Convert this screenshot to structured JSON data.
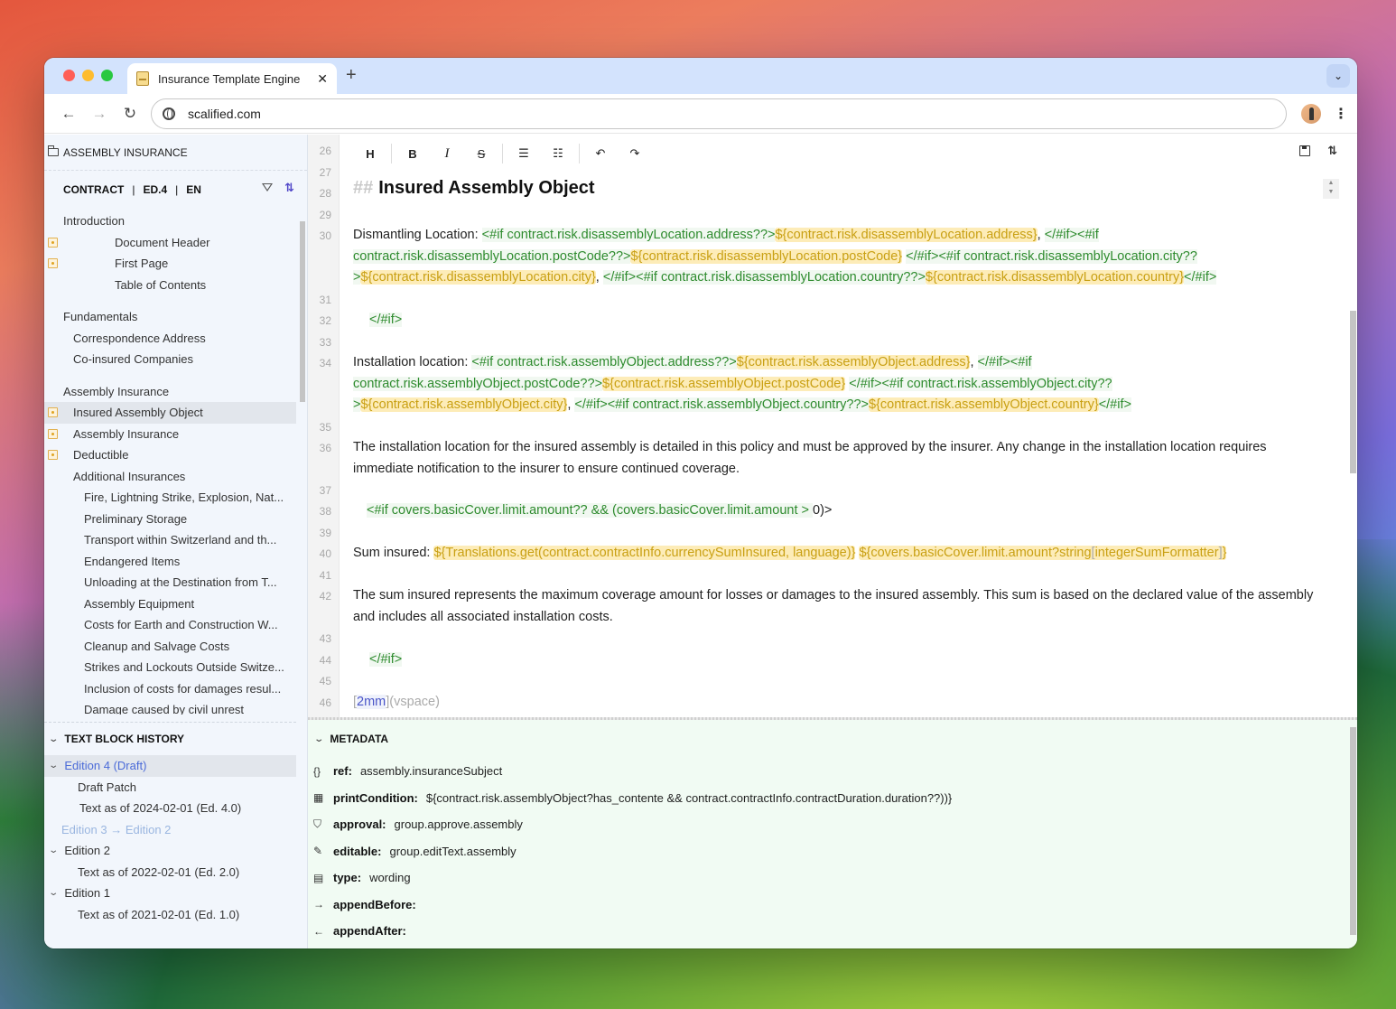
{
  "browser": {
    "tab_title": "Insurance Template Engine",
    "url": "scalified.com",
    "close_glyph": "✕",
    "new_tab_glyph": "+",
    "back_glyph": "←",
    "forward_glyph": "→",
    "reload_glyph": "↻",
    "menu_glyph": "⋮",
    "tab_menu_glyph": "⌄"
  },
  "sidebar": {
    "title": "ASSEMBLY INSURANCE",
    "context": {
      "type": "CONTRACT",
      "edition": "ED.4",
      "language": "EN",
      "separator": "|"
    },
    "sync_glyph": "⇅",
    "tree": [
      {
        "label": "Introduction",
        "level": 0,
        "group": true,
        "first": true
      },
      {
        "label": "Document Header",
        "level": 3,
        "marker": true
      },
      {
        "label": "First Page",
        "level": 3,
        "marker": true
      },
      {
        "label": "Table of Contents",
        "level": 3
      },
      {
        "label": "Fundamentals",
        "level": 0,
        "group": true
      },
      {
        "label": "Correspondence Address",
        "level": 1
      },
      {
        "label": "Co-insured Companies",
        "level": 1
      },
      {
        "label": "Assembly Insurance",
        "level": 0,
        "group": true
      },
      {
        "label": "Insured Assembly Object",
        "level": 1,
        "marker": true,
        "selected": true
      },
      {
        "label": "Assembly Insurance",
        "level": 1,
        "marker": true
      },
      {
        "label": "Deductible",
        "level": 1,
        "marker": true
      },
      {
        "label": "Additional Insurances",
        "level": 1
      },
      {
        "label": "Fire, Lightning Strike, Explosion, Nat...",
        "level": 2
      },
      {
        "label": "Preliminary Storage",
        "level": 2
      },
      {
        "label": "Transport within Switzerland and th...",
        "level": 2
      },
      {
        "label": "Endangered Items",
        "level": 2
      },
      {
        "label": "Unloading at the Destination from T...",
        "level": 2
      },
      {
        "label": "Assembly Equipment",
        "level": 2
      },
      {
        "label": "Costs for Earth and Construction W...",
        "level": 2
      },
      {
        "label": "Cleanup and Salvage Costs",
        "level": 2
      },
      {
        "label": "Strikes and Lockouts Outside Switze...",
        "level": 2
      },
      {
        "label": "Inclusion of costs for damages resul...",
        "level": 2
      },
      {
        "label": "Damage caused by civil unrest",
        "level": 2
      }
    ]
  },
  "history": {
    "title": "TEXT BLOCK HISTORY",
    "chevron": "⌄",
    "items": [
      {
        "label": "Edition 4 (Draft)",
        "kind": "edition",
        "selected": true,
        "expanded": true
      },
      {
        "label": "Draft Patch",
        "kind": "child"
      },
      {
        "label": "Text as of 2024-02-01 (Ed. 4.0)",
        "kind": "child2"
      },
      {
        "label": "Edition 3 → Edition 2",
        "kind": "muted"
      },
      {
        "label": "Edition 2",
        "kind": "edition",
        "expanded": true
      },
      {
        "label": "Text as of 2022-02-01 (Ed. 2.0)",
        "kind": "child"
      },
      {
        "label": "Edition 1",
        "kind": "edition",
        "expanded": true
      },
      {
        "label": "Text as of 2021-02-01 (Ed. 1.0)",
        "kind": "child"
      }
    ]
  },
  "editor": {
    "toolbar": {
      "heading": "H",
      "bold": "B",
      "italic": "I",
      "strike": "S",
      "bullet_list": "☰",
      "ordered_list": "☷",
      "undo": "↶",
      "redo": "↷"
    },
    "line_numbers": [
      "26",
      "27",
      "28",
      "29",
      "30",
      "31",
      "32",
      "33",
      "34",
      "35",
      "36",
      "37",
      "38",
      "39",
      "40",
      "41",
      "42",
      "43",
      "44",
      "45",
      "46"
    ],
    "heading": {
      "hashes": "##",
      "text": "Insured Assembly Object"
    },
    "dismantling": {
      "label": "Dismantling Location: ",
      "if_address": "<#if contract.risk.disassemblyLocation.address??>",
      "var_address": "${contract.risk.disassemblyLocation.address}",
      "comma1": ", ",
      "endif1": "</#if>",
      "if_postcode_a": "<#if",
      "if_postcode_b": "contract.risk.disassemblyLocation.postCode??>",
      "var_postcode": "${contract.risk.disassemblyLocation.postCode}",
      "endif2": "</#if>",
      "if_city": "<#if contract.risk.disassemblyLocation.city??",
      "if_city_close": ">",
      "var_city": "${contract.risk.disassemblyLocation.city}",
      "comma2": ", ",
      "endif3": "</#if>",
      "if_country": "<#if contract.risk.disassemblyLocation.country??>",
      "var_country": "${contract.risk.disassemblyLocation.country}",
      "endif4": "</#if>"
    },
    "endif_32": "</#if>",
    "installation": {
      "label": "Installation location: ",
      "if_address": "<#if contract.risk.assemblyObject.address??>",
      "var_address": "${contract.risk.assemblyObject.address}",
      "comma1": ", ",
      "endif1": "</#if>",
      "if_postcode_a": "<#if",
      "if_postcode_b": "contract.risk.assemblyObject.postCode??>",
      "var_postcode": "${contract.risk.assemblyObject.postCode}",
      "endif2": "</#if>",
      "if_city": "<#if contract.risk.assemblyObject.city??",
      "if_city_close": ">",
      "var_city": "${contract.risk.assemblyObject.city}",
      "comma2": ", ",
      "endif3": "</#if>",
      "if_country": "<#if contract.risk.assemblyObject.country??>",
      "var_country": "${contract.risk.assemblyObject.country}",
      "endif4": "</#if>"
    },
    "para_36": "The installation location for the insured assembly is detailed in this policy and must be approved by the insurer. Any change in the installation location requires immediate notification to the insurer to ensure continued coverage.",
    "if_38_a": "<#if covers.basicCover.limit.amount?? && (covers.basicCover.limit.amount > ",
    "if_38_b": "0)>",
    "sum": {
      "label": "Sum insured: ",
      "var_currency": "${Translations.get(contract.contractInfo.currencySumInsured, language)}",
      "var_amount_a": "${covers.basicCover.limit.amount?string",
      "var_amount_bracket_open": "[",
      "var_amount_b": "integerSumFormatter",
      "var_amount_bracket_close": "]",
      "var_amount_c": "}"
    },
    "para_42": "The sum insured represents the maximum coverage amount for losses or damages to the insured assembly. This sum is based on the declared value of the assembly and includes all associated installation costs.",
    "endif_44": "</#if>",
    "vspace": {
      "open": "[",
      "value": "2mm",
      "close": "]",
      "command": "(vspace)"
    }
  },
  "metadata": {
    "title": "METADATA",
    "rows": [
      {
        "icon": "{}",
        "key": "ref:",
        "value": "assembly.insuranceSubject"
      },
      {
        "icon": "▦",
        "key": "printCondition:",
        "value": "${contract.risk.assemblyObject?has_contente && contract.contractInfo.contractDuration.duration??))}"
      },
      {
        "icon": "⛉",
        "key": "approval:",
        "value": "group.approve.assembly"
      },
      {
        "icon": "✎",
        "key": "editable:",
        "value": "group.editText.assembly"
      },
      {
        "icon": "▤",
        "key": "type:",
        "value": "wording"
      },
      {
        "icon": "→",
        "key": "appendBefore:",
        "value": ""
      },
      {
        "icon": "←",
        "key": "appendAfter:",
        "value": ""
      }
    ]
  }
}
